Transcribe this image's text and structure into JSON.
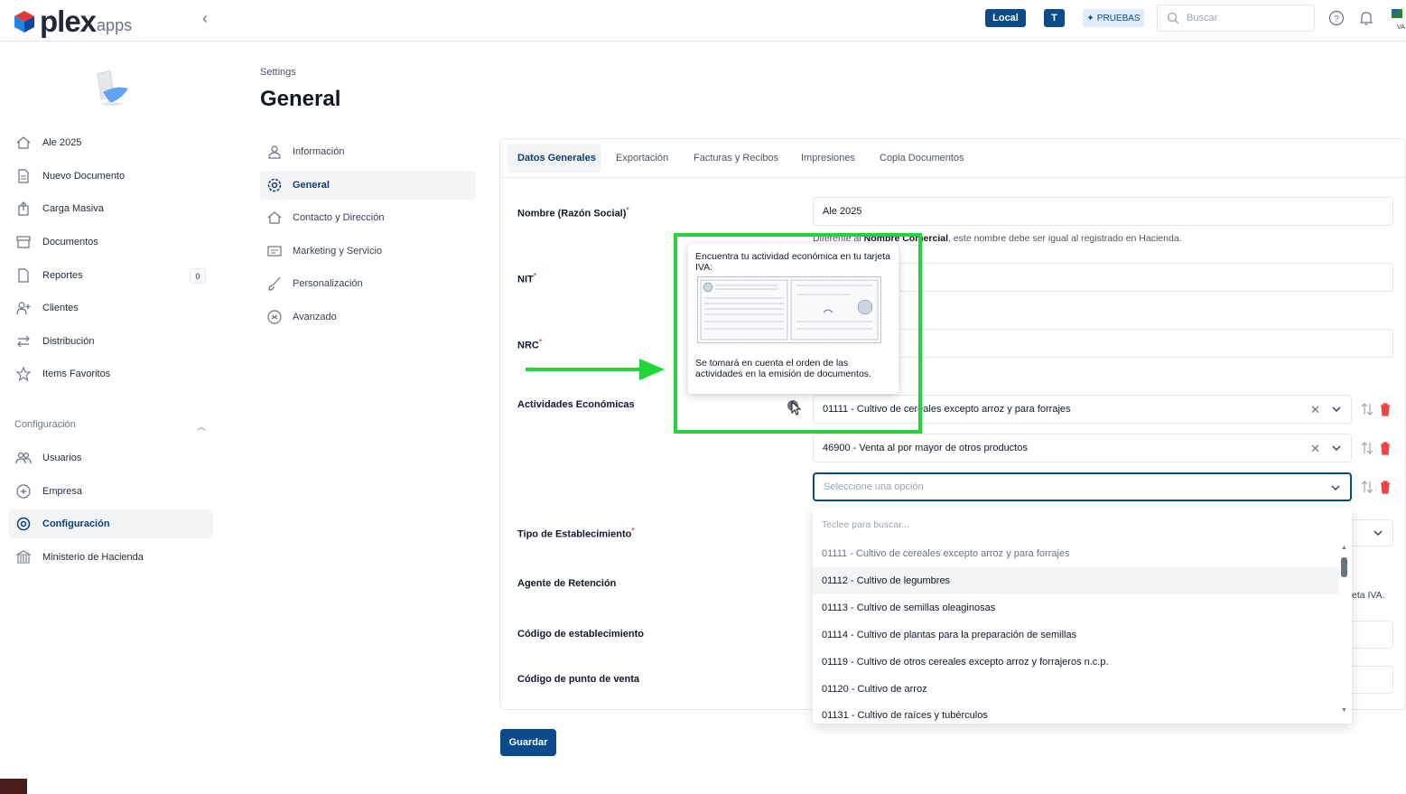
{
  "header": {
    "brand": "plex",
    "brand_suffix": "apps",
    "badge_local": "Local",
    "badge_user": "T",
    "badge_env": "PRUEBAS",
    "search_placeholder": "Buscar"
  },
  "sidebar": {
    "items": [
      {
        "label": "Ale 2025",
        "icon": "home-icon"
      },
      {
        "label": "Nuevo Documento",
        "icon": "document-icon"
      },
      {
        "label": "Carga Masiva",
        "icon": "upload-icon"
      },
      {
        "label": "Documentos",
        "icon": "archive-icon"
      },
      {
        "label": "Reportes",
        "icon": "report-icon",
        "count": "0"
      },
      {
        "label": "Clientes",
        "icon": "user-add-icon"
      },
      {
        "label": "Distribución",
        "icon": "swap-icon"
      },
      {
        "label": "Items Favoritos",
        "icon": "star-icon"
      }
    ],
    "section_title": "Configuración",
    "config_items": [
      {
        "label": "Usuarios",
        "icon": "users-icon"
      },
      {
        "label": "Empresa",
        "icon": "building-icon"
      },
      {
        "label": "Configuración",
        "icon": "gear-icon",
        "active": true
      },
      {
        "label": "Ministerio de Hacienda",
        "icon": "bank-icon"
      }
    ]
  },
  "settings": {
    "breadcrumb": "Settings",
    "title": "General",
    "items": [
      {
        "label": "Información"
      },
      {
        "label": "General",
        "active": true
      },
      {
        "label": "Contacto y Dirección"
      },
      {
        "label": "Marketing y Servicio"
      },
      {
        "label": "Personalización"
      },
      {
        "label": "Avanzado"
      }
    ]
  },
  "tabs": [
    "Datos Generales",
    "Exportación",
    "Facturas y Recibos",
    "Impresiones",
    "Copia Documentos"
  ],
  "form": {
    "nombre_label": "Nombre (Razón Social)",
    "nombre_value": "Ale 2025",
    "help_pre": "Diferente al ",
    "help_bold": "Nombre Comercial",
    "help_post": ", este nombre debe ser igual al registrado en Hacienda.",
    "nit_label": "NIT",
    "nrc_label": "NRC",
    "actividades_label": "Actividades Económicas",
    "actividad_1": "01111 - Cultivo de cereales excepto arroz y para forrajes",
    "actividad_2": "46900 - Venta al por mayor de otros productos",
    "actividad_placeholder": "Seleccione una opción",
    "tipo_label": "Tipo de Establecimiento",
    "agente_label": "Agente de Retención",
    "agente_help_tail": "eta IVA.",
    "codigo_est_label": "Código de establecimiento",
    "codigo_pv_label": "Código de punto de venta",
    "save_label": "Guardar"
  },
  "dropdown": {
    "search_placeholder": "Teclee para buscar...",
    "options": [
      "01111 - Cultivo de cereales excepto arroz y para forrajes",
      "01112 - Cultivo de legumbres",
      "01113 - Cultivo de semillas oleaginosas",
      "01114 - Cultivo de plantas para la preparación de semillas",
      "01119 - Cultivo de otros cereales excepto arroz y forrajeros n.c.p.",
      "01120 - Cultivo de arroz",
      "01131 - Cultivo de raíces y tubérculos"
    ]
  },
  "tooltip": {
    "text_top": "Encuentra tu actividad económica en tu tarjeta IVA:",
    "text_bottom": "Se tomará en cuenta el orden de las actividades en la emisión de documentos."
  },
  "colors": {
    "primary": "#0b4a8b",
    "highlight": "#21d43a",
    "danger": "#ef4444"
  }
}
